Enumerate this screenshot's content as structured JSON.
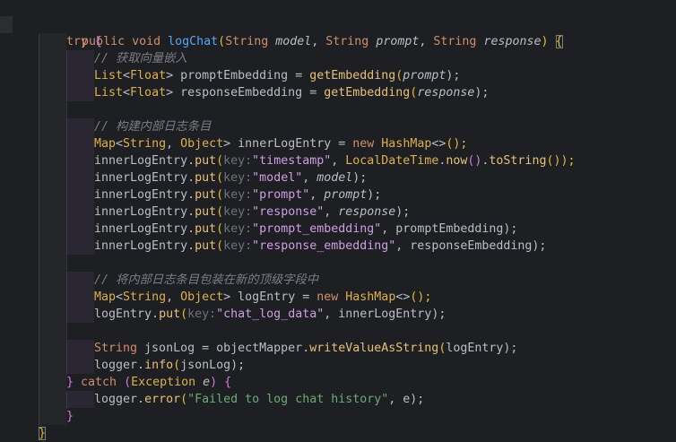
{
  "editor": {
    "lines": [
      [
        "public void ",
        "logChat",
        "(",
        "String ",
        "model",
        ", ",
        "String ",
        "prompt",
        ", ",
        "String ",
        "response",
        ") ",
        "{"
      ],
      [
        "try ",
        "{"
      ],
      [
        "// 获取向量嵌入"
      ],
      [
        "List",
        "<",
        "Float",
        "> ",
        "promptEmbedding ",
        "= ",
        "getEmbedding",
        "(",
        "prompt",
        ");"
      ],
      [
        "List",
        "<",
        "Float",
        "> ",
        "responseEmbedding ",
        "= ",
        "getEmbedding",
        "(",
        "response",
        ");"
      ],
      [],
      [
        "// 构建内部日志条目"
      ],
      [
        "Map",
        "<",
        "String",
        ", ",
        "Object",
        "> ",
        "innerLogEntry ",
        "= ",
        "new ",
        "HashMap",
        "<>",
        "();"
      ],
      [
        "innerLogEntry",
        ".",
        "put",
        "(",
        "key:",
        "\"timestamp\"",
        ", ",
        "LocalDateTime",
        ".",
        "now",
        "()",
        ".",
        "toString",
        "());"
      ],
      [
        "innerLogEntry",
        ".",
        "put",
        "(",
        "key:",
        "\"model\"",
        ", ",
        "model",
        ");"
      ],
      [
        "innerLogEntry",
        ".",
        "put",
        "(",
        "key:",
        "\"prompt\"",
        ", ",
        "prompt",
        ");"
      ],
      [
        "innerLogEntry",
        ".",
        "put",
        "(",
        "key:",
        "\"response\"",
        ", ",
        "response",
        ");"
      ],
      [
        "innerLogEntry",
        ".",
        "put",
        "(",
        "key:",
        "\"prompt_embedding\"",
        ", ",
        "promptEmbedding",
        ");"
      ],
      [
        "innerLogEntry",
        ".",
        "put",
        "(",
        "key:",
        "\"response_embedding\"",
        ", ",
        "responseEmbedding",
        ");"
      ],
      [],
      [
        "// 将内部日志条目包装在新的顶级字段中"
      ],
      [
        "Map",
        "<",
        "String",
        ", ",
        "Object",
        "> ",
        "logEntry ",
        "= ",
        "new ",
        "HashMap",
        "<>",
        "();"
      ],
      [
        "logEntry",
        ".",
        "put",
        "(",
        "key:",
        "\"chat_log_data\"",
        ", ",
        "innerLogEntry",
        ");"
      ],
      [],
      [
        "String ",
        "jsonLog ",
        "= ",
        "objectMapper",
        ".",
        "writeValueAsString",
        "(",
        "logEntry",
        ");"
      ],
      [
        "logger",
        ".",
        "info",
        "(",
        "jsonLog",
        ");"
      ],
      [
        "} ",
        "catch ",
        "(",
        "Exception ",
        "e",
        ") ",
        "{"
      ],
      [
        "logger",
        ".",
        "error",
        "(",
        "\"Failed to log chat history\"",
        ", ",
        "e",
        ");"
      ],
      [
        "}"
      ],
      [
        "}"
      ]
    ]
  }
}
